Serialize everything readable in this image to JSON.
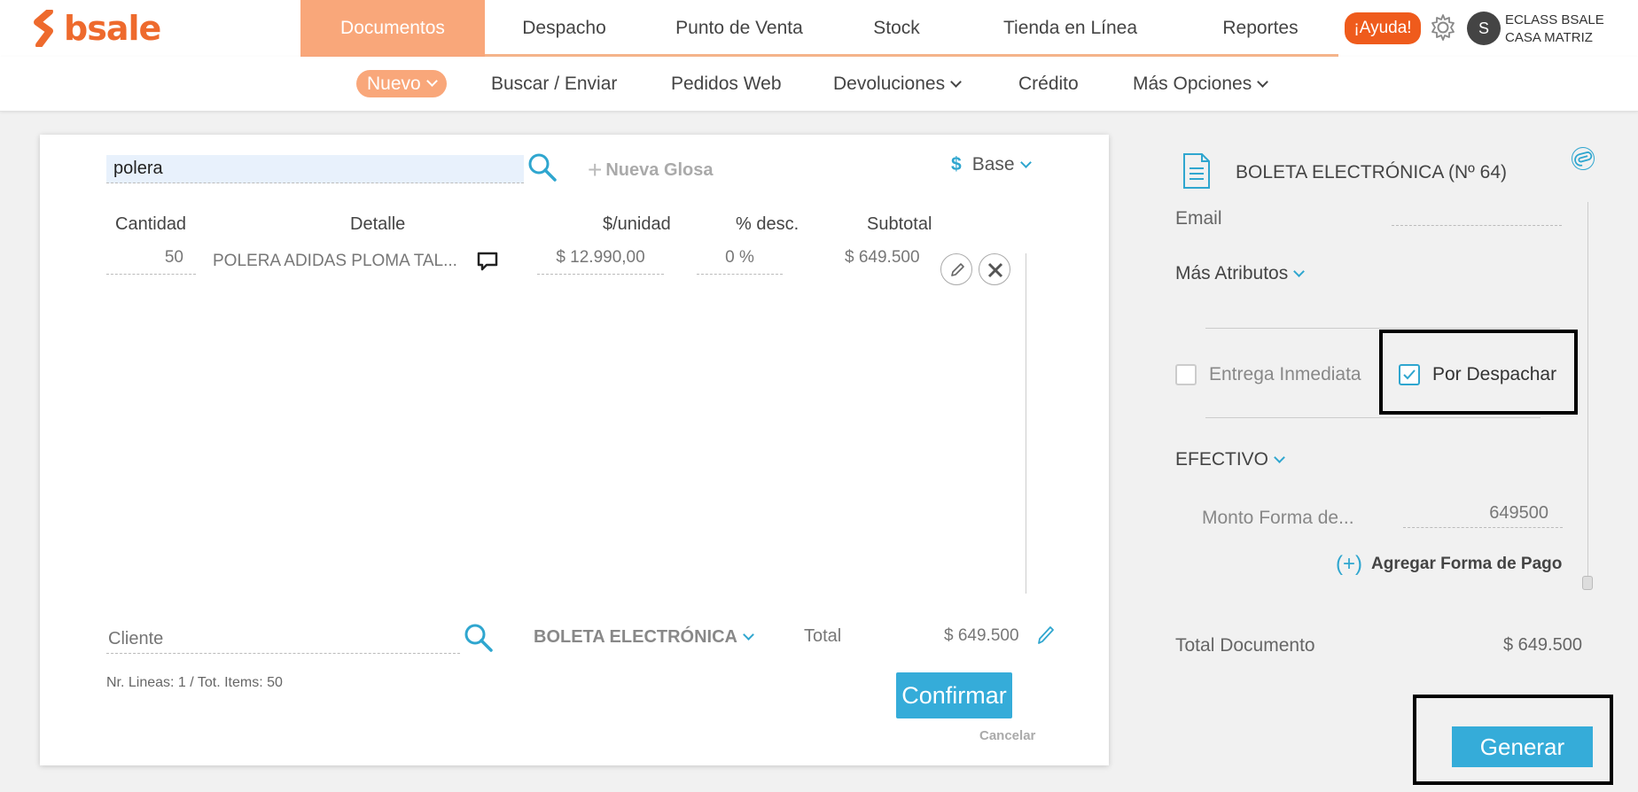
{
  "brand": {
    "name": "bsale",
    "color": "#ee6a2d"
  },
  "nav": {
    "items": [
      "Documentos",
      "Despacho",
      "Punto de Venta",
      "Stock",
      "Tienda en Línea",
      "Reportes"
    ],
    "active": "Documentos"
  },
  "header": {
    "help": "¡Ayuda!",
    "avatar_initial": "S",
    "company_line1": "ECLASS BSALE",
    "company_line2": "CASA MATRIZ"
  },
  "subnav": {
    "nuevo": "Nuevo",
    "buscar": "Buscar / Enviar",
    "pedidos": "Pedidos Web",
    "devoluciones": "Devoluciones",
    "credito": "Crédito",
    "mas": "Más Opciones"
  },
  "editor": {
    "search_value": "polera",
    "nueva_glosa": "Nueva Glosa",
    "currency_symbol": "$",
    "price_list": "Base",
    "columns": {
      "cantidad": "Cantidad",
      "detalle": "Detalle",
      "unidad": "$/unidad",
      "desc": "% desc.",
      "subtotal": "Subtotal"
    },
    "rows": [
      {
        "cantidad": "50",
        "detalle": "POLERA ADIDAS PLOMA TAL...",
        "unidad": "$ 12.990,00",
        "desc": "0 %",
        "subtotal": "$ 649.500"
      }
    ],
    "cliente_placeholder": "Cliente",
    "doc_type": "BOLETA ELECTRÓNICA",
    "total_label": "Total",
    "total_value": "$ 649.500",
    "lines_info": "Nr. Lineas: 1 / Tot. Items: 50",
    "confirm": "Confirmar",
    "cancel": "Cancelar"
  },
  "side": {
    "doc_title": "BOLETA ELECTRÓNICA (Nº 64)",
    "email_label": "Email",
    "mas_atributos": "Más Atributos",
    "entrega_inmediata": "Entrega Inmediata",
    "por_despachar": "Por Despachar",
    "por_despachar_checked": true,
    "entrega_inmediata_checked": false,
    "payment_method": "EFECTIVO",
    "monto_label": "Monto Forma de...",
    "monto_value": "649500",
    "add_pago": "Agregar Forma de Pago",
    "total_doc_label": "Total Documento",
    "total_doc_value": "$ 649.500",
    "generar": "Generar"
  },
  "colors": {
    "accent": "#35acd9",
    "nav_active": "#f9a77a",
    "help": "#ef5b1c"
  }
}
